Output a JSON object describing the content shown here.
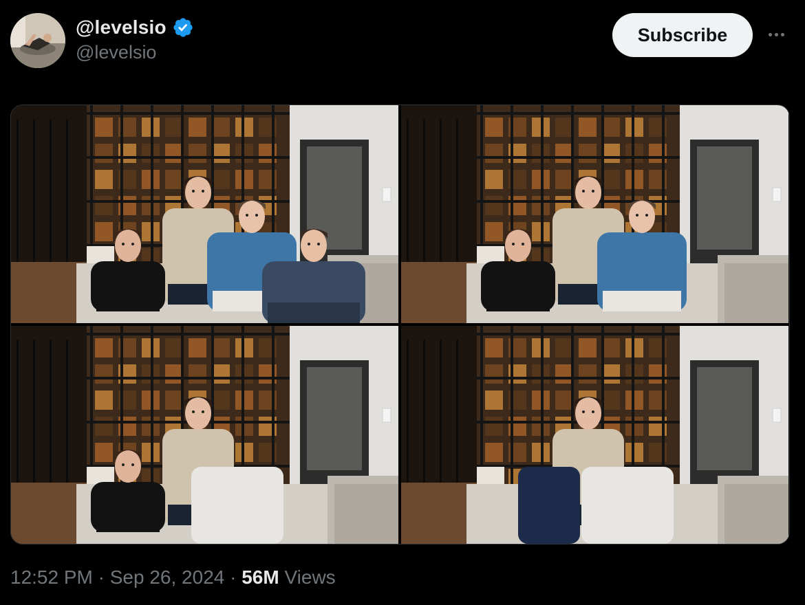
{
  "author": {
    "display_name": "@levelsio",
    "handle": "@levelsio",
    "avatar_icon": "avatar-photo",
    "verified_icon": "verified-badge-icon",
    "verified_color": "#1d9bf0"
  },
  "actions": {
    "subscribe_label": "Subscribe",
    "more_icon": "more-dots-icon"
  },
  "media": {
    "photos": [
      {
        "people": 4,
        "pillows": []
      },
      {
        "people": 3,
        "pillows": []
      },
      {
        "people": 2,
        "pillows": [
          "white"
        ]
      },
      {
        "people": 1,
        "pillows": [
          "navy",
          "white"
        ]
      }
    ]
  },
  "meta": {
    "time": "12:52 PM",
    "separator": "·",
    "date": "Sep 26, 2024",
    "views_count": "56M",
    "views_label": "Views"
  }
}
